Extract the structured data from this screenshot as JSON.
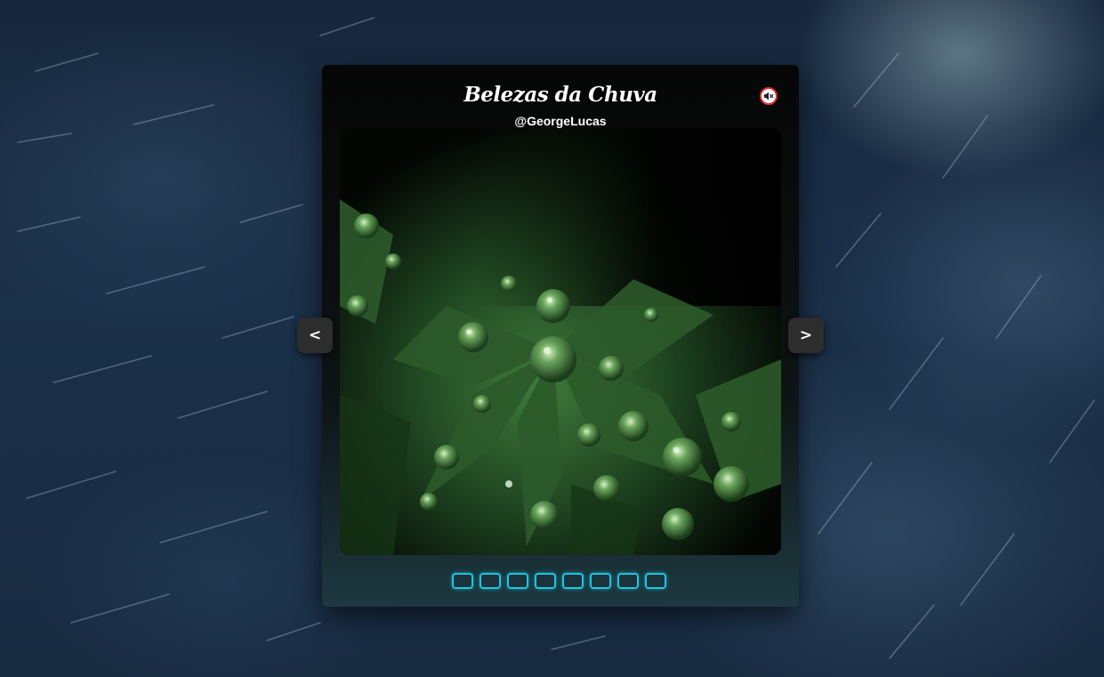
{
  "gallery": {
    "title": "Belezas da Chuva",
    "author": "@GeorgeLucas",
    "prev_label": "<",
    "next_label": ">",
    "mute_icon": "speaker-muted-icon",
    "photo_subject": "image-icon",
    "slide_count": 8,
    "accent_color": "#1ec6e4",
    "mute_color": "#e03131"
  }
}
